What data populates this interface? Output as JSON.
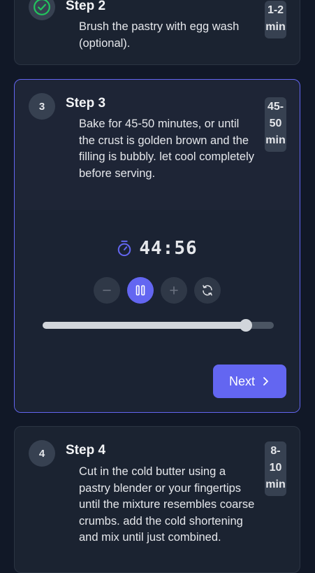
{
  "steps": [
    {
      "number": "2",
      "title": "Step 2",
      "description": "Brush the pastry with egg wash (optional).",
      "duration": "1-2 min",
      "status": "completed"
    },
    {
      "number": "3",
      "title": "Step 3",
      "description": "Bake for 45-50 minutes, or until the crust is golden brown and the filling is bubbly. let cool completely before serving.",
      "duration": "45-50 min",
      "status": "active"
    },
    {
      "number": "4",
      "title": "Step 4",
      "description": "Cut in the cold butter using a pastry blender or your fingertips until the mixture resembles coarse crumbs. add the cold shortening and mix until just combined.",
      "duration": "8-10 min",
      "status": "pending"
    }
  ],
  "timer": {
    "time": "44:56",
    "progress": 0.88,
    "controls": [
      "minus-icon",
      "pause-icon",
      "plus-icon",
      "reset-icon"
    ]
  },
  "next_label": "Next",
  "colors": {
    "accent": "#6366f1",
    "check": "#22c55e",
    "background": "#111827",
    "card": "#1b2331"
  }
}
